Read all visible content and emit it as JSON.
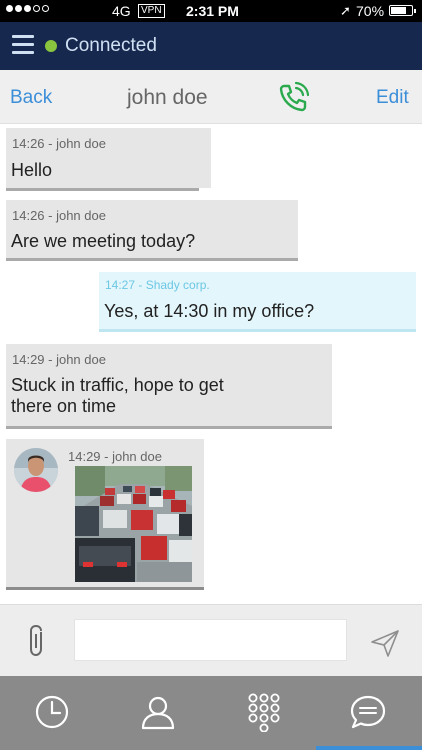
{
  "status_bar": {
    "network": "4G",
    "vpn": "VPN",
    "time": "2:31 PM",
    "battery": "70%",
    "location_icon": "location-arrow-icon"
  },
  "connection": {
    "label": "Connected",
    "status_color": "#8ac53f"
  },
  "nav": {
    "back_label": "Back",
    "title": "john doe",
    "edit_label": "Edit",
    "call_icon": "phone-call-icon",
    "call_color": "#2aa94d"
  },
  "messages": [
    {
      "meta": "14:26 - john doe",
      "text": "Hello",
      "direction": "in"
    },
    {
      "meta": "14:26 - john doe",
      "text": "Are we meeting today?",
      "direction": "in"
    },
    {
      "meta": "14:27 - Shady corp.",
      "text": "Yes, at 14:30 in my office?",
      "direction": "out"
    },
    {
      "meta": "14:29 - john doe",
      "text_lines": [
        "Stuck in traffic, hope to get",
        "there on time"
      ],
      "direction": "in"
    },
    {
      "meta": "14:29 - john doe",
      "attachment": "traffic-photo",
      "direction": "in"
    }
  ],
  "composer": {
    "placeholder": "",
    "attach_icon": "paperclip-icon",
    "send_icon": "send-icon"
  },
  "tabs": [
    {
      "name": "history",
      "icon": "clock-icon"
    },
    {
      "name": "contacts",
      "icon": "user-icon"
    },
    {
      "name": "dialpad",
      "icon": "dialpad-icon"
    },
    {
      "name": "chat",
      "icon": "chat-bubble-icon",
      "active": true
    }
  ],
  "colors": {
    "accent": "#3b8ed8",
    "header_bg": "#17284e",
    "incoming_bubble": "#e6e6e6",
    "outgoing_bubble": "#e3f6fb"
  }
}
